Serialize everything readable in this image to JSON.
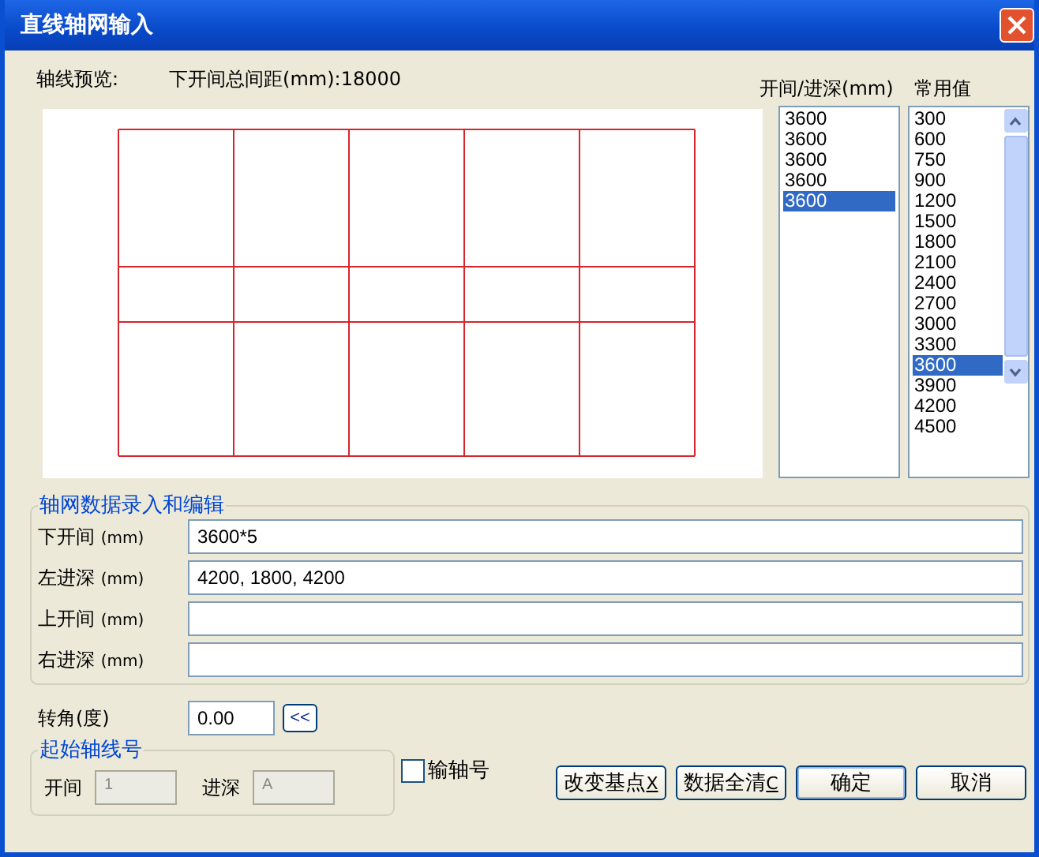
{
  "window": {
    "title": "直线轴网输入"
  },
  "preview": {
    "label": "轴线预览:",
    "total": "下开间总间距(mm):18000"
  },
  "spans": {
    "header": "开间/进深(mm)",
    "items": [
      {
        "text": "3600",
        "selected": false
      },
      {
        "text": "3600",
        "selected": false
      },
      {
        "text": "3600",
        "selected": false
      },
      {
        "text": "3600",
        "selected": false
      },
      {
        "text": "3600",
        "selected": true
      }
    ]
  },
  "common": {
    "header": "常用值",
    "items": [
      {
        "text": "300",
        "selected": false
      },
      {
        "text": "600",
        "selected": false
      },
      {
        "text": "750",
        "selected": false
      },
      {
        "text": "900",
        "selected": false
      },
      {
        "text": "1200",
        "selected": false
      },
      {
        "text": "1500",
        "selected": false
      },
      {
        "text": "1800",
        "selected": false
      },
      {
        "text": "2100",
        "selected": false
      },
      {
        "text": "2400",
        "selected": false
      },
      {
        "text": "2700",
        "selected": false
      },
      {
        "text": "3000",
        "selected": false
      },
      {
        "text": "3300",
        "selected": false
      },
      {
        "text": "3600",
        "selected": true
      },
      {
        "text": "3900",
        "selected": false
      },
      {
        "text": "4200",
        "selected": false
      },
      {
        "text": "4500",
        "selected": false
      }
    ]
  },
  "data_group": {
    "title": "轴网数据录入和编辑",
    "rows": [
      {
        "label": "下开间",
        "unit": "(mm)",
        "value": "3600*5"
      },
      {
        "label": "左进深",
        "unit": "(mm)",
        "value": "4200, 1800, 4200"
      },
      {
        "label": "上开间",
        "unit": "(mm)"
      },
      {
        "label": "右进深",
        "unit": "(mm)"
      }
    ]
  },
  "rotation": {
    "label": "转角(度)",
    "value": "0.00",
    "button": "<<"
  },
  "start_group": {
    "title": "起始轴线号",
    "fields": [
      {
        "label": "开间",
        "value": "1",
        "disabled": true
      },
      {
        "label": "进深",
        "value": "A",
        "disabled": true
      }
    ]
  },
  "checkbox": {
    "label": "输轴号",
    "checked": false
  },
  "buttons": [
    {
      "label": "改变基点",
      "hotkey": "X",
      "default": false
    },
    {
      "label": "数据全清",
      "hotkey": "C",
      "default": false
    },
    {
      "label": "确定",
      "default": true
    },
    {
      "label": "取消",
      "default": false
    }
  ]
}
